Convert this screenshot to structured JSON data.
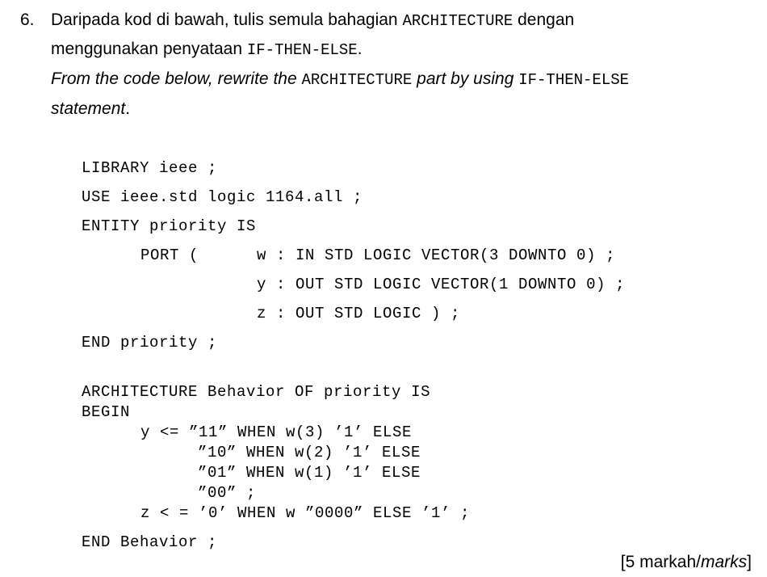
{
  "question": {
    "number": "6.",
    "ms_part1": "Daripada kod di bawah, tulis semula bahagian ",
    "ms_code1": "ARCHITECTURE",
    "ms_part2": " dengan",
    "ms_part3": "menggunakan penyataan ",
    "ms_code2": "IF-THEN-ELSE",
    "ms_part4": ".",
    "en_part1": "From the code below, rewrite the ",
    "en_code1": "ARCHITECTURE",
    "en_part2": " part by using ",
    "en_code2": "IF-THEN-ELSE",
    "en_part3": "statement",
    "en_part4": "."
  },
  "code_lines": [
    "LIBRARY ieee ;",
    "USE ieee.std logic 1164.all ;",
    "ENTITY priority IS",
    "PORT (",
    "w : IN STD LOGIC VECTOR(3 DOWNTO 0) ;",
    "y : OUT STD LOGIC VECTOR(1 DOWNTO 0) ;",
    "z : OUT STD LOGIC ) ;",
    "END priority ;",
    "ARCHITECTURE Behavior OF priority IS",
    "BEGIN",
    "y <= ”11” WHEN w(3) ’1’ ELSE",
    "”10” WHEN w(2) ’1’ ELSE",
    "”01” WHEN w(1) ’1’ ELSE",
    "”00” ;",
    "z < = ’0’ WHEN w ”0000” ELSE ’1’ ;",
    "END Behavior ;"
  ],
  "marks": {
    "prefix": "[5 markah/",
    "italic": "marks",
    "suffix": "]"
  }
}
